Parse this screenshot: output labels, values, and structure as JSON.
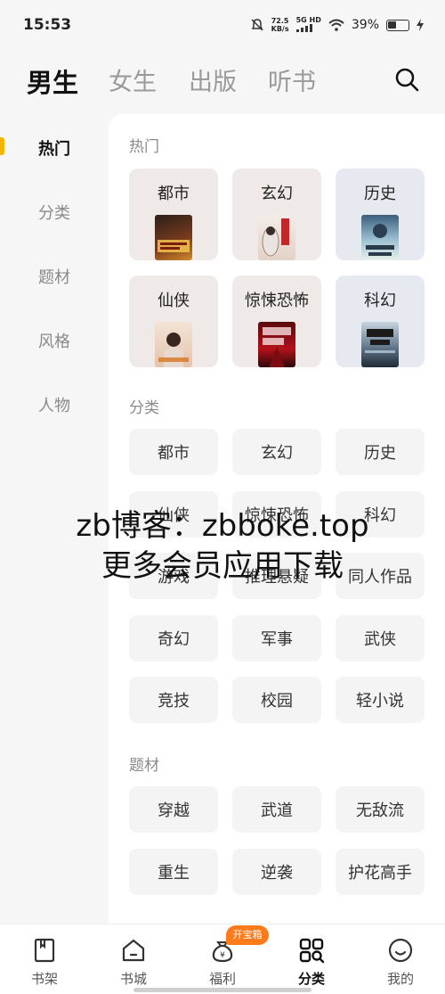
{
  "status_bar": {
    "time": "15:53",
    "speed_value": "72.5",
    "speed_unit": "KB/s",
    "network_top": "5G HD",
    "network_bottom": "",
    "battery": "39%"
  },
  "top_tabs": [
    {
      "label": "男生"
    },
    {
      "label": "女生"
    },
    {
      "label": "出版"
    },
    {
      "label": "听书"
    }
  ],
  "sidebar": {
    "items": [
      {
        "label": "热门"
      },
      {
        "label": "分类"
      },
      {
        "label": "题材"
      },
      {
        "label": "风格"
      },
      {
        "label": "人物"
      }
    ]
  },
  "sections": {
    "hot": {
      "title": "热门",
      "cards": [
        {
          "label": "都市",
          "cover_text": "高武：开局上门送"
        },
        {
          "label": "玄幻",
          "cover_text": "我的剑道"
        },
        {
          "label": "历史",
          "cover_text": "从县令开始争霸天下"
        },
        {
          "label": "仙侠",
          "cover_text": "女帝师尊在上"
        },
        {
          "label": "惊悚恐怖",
          "cover_text": "美人棺"
        },
        {
          "label": "科幻",
          "cover_text": "高维入侵"
        }
      ]
    },
    "category": {
      "title": "分类",
      "items": [
        "都市",
        "玄幻",
        "历史",
        "仙侠",
        "惊悚恐怖",
        "科幻",
        "游戏",
        "推理悬疑",
        "同人作品",
        "奇幻",
        "军事",
        "武侠",
        "竞技",
        "校园",
        "轻小说"
      ]
    },
    "theme": {
      "title": "题材",
      "items": [
        "穿越",
        "武道",
        "无敌流",
        "重生",
        "逆袭",
        "护花高手"
      ]
    }
  },
  "watermark": {
    "line1": "zb博客：zbboke.top",
    "line2": "更多会员应用下载"
  },
  "bottom_nav": {
    "items": [
      {
        "label": "书架",
        "icon": "bookshelf-icon"
      },
      {
        "label": "书城",
        "icon": "bookstore-icon"
      },
      {
        "label": "福利",
        "icon": "bonus-bag-icon"
      },
      {
        "label": "分类",
        "icon": "category-icon"
      },
      {
        "label": "我的",
        "icon": "profile-icon"
      }
    ],
    "badge": "开宝箱"
  },
  "colors": {
    "accent": "#f5b400",
    "badge": "#ff7a1a",
    "hot_warm_bg": "#efe9e8",
    "hot_cool_bg": "#e6e9ef"
  }
}
